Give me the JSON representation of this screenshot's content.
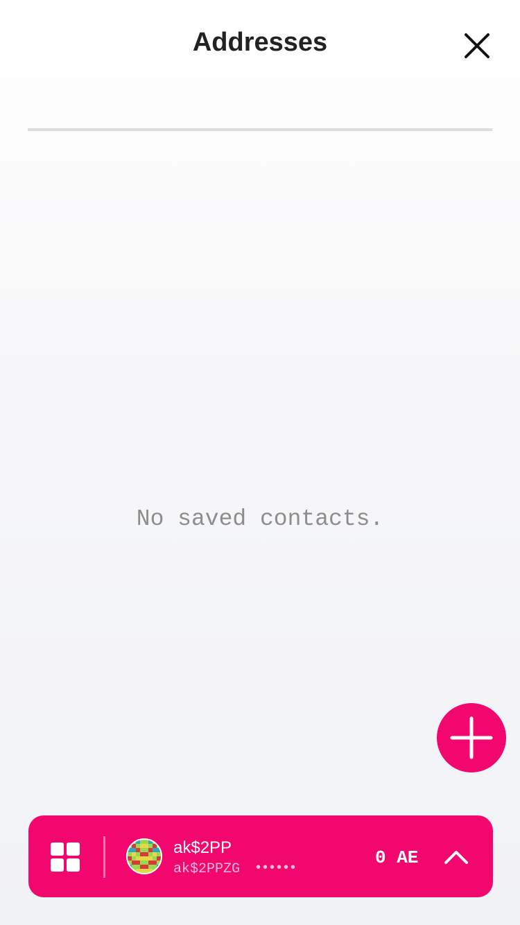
{
  "header": {
    "title": "Addresses",
    "close_icon": "close-icon"
  },
  "contacts": {
    "items": [],
    "empty_message": "No saved contacts."
  },
  "fab": {
    "icon": "plus-icon",
    "color": "#f2076f"
  },
  "account_bar": {
    "color": "#f2076f",
    "menu_icon": "grid-icon",
    "account_name": "ak$2PP",
    "account_address": "ak$2PPZG",
    "address_mask": "••••••",
    "balance": "0 AE",
    "expand_icon": "chevron-up-icon"
  }
}
